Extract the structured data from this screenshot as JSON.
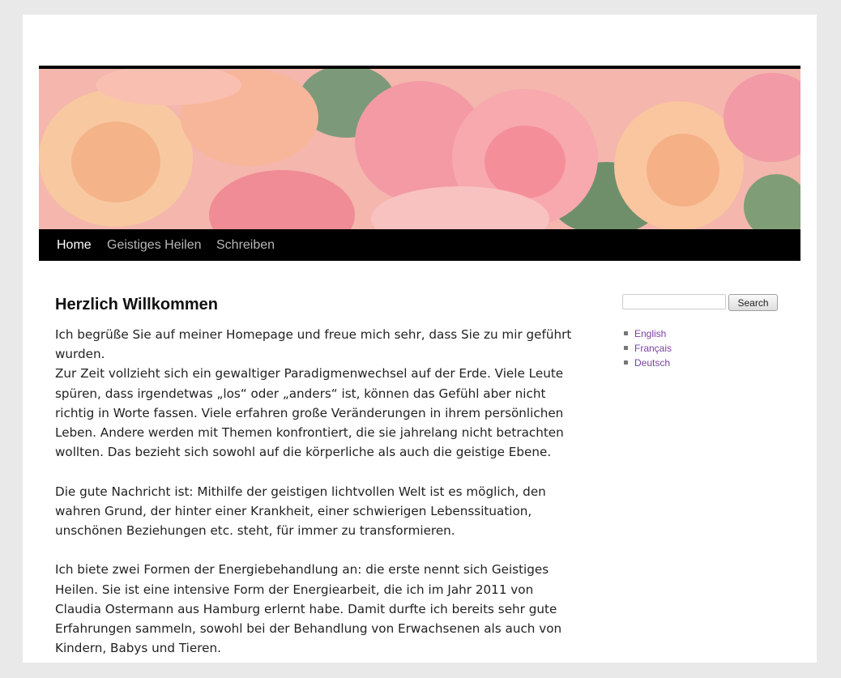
{
  "header_image": {
    "description_icon": "roses-banner"
  },
  "nav": {
    "items": [
      {
        "label": "Home",
        "active": true
      },
      {
        "label": "Geistiges Heilen",
        "active": false
      },
      {
        "label": "Schreiben",
        "active": false
      }
    ]
  },
  "main": {
    "title": "Herzlich Willkommen",
    "paragraphs": [
      "Ich begrüße Sie auf meiner Homepage und freue mich sehr, dass Sie zu mir geführt wurden.",
      "Zur Zeit vollzieht sich ein gewaltiger Paradigmenwechsel auf der Erde. Viele Leute spüren, dass irgendetwas „los“ oder „anders“ ist, können das Gefühl aber nicht richtig in Worte fassen. Viele erfahren große Veränderungen in ihrem persönlichen Leben. Andere werden mit Themen konfrontiert, die sie jahrelang nicht betrachten wollten. Das bezieht sich sowohl auf die körperliche als auch die geistige Ebene.",
      "Die gute Nachricht ist: Mithilfe der geistigen lichtvollen Welt ist es möglich, den wahren Grund, der hinter einer Krankheit, einer schwierigen Lebenssituation, unschönen Beziehungen etc. steht, für immer zu transformieren.",
      "Ich biete zwei Formen der Energiebehandlung an: die erste nennt sich Geistiges Heilen. Sie ist eine intensive Form der Energiearbeit, die ich im Jahr 2011 von Claudia Ostermann aus Hamburg erlernt habe. Damit durfte ich bereits sehr gute Erfahrungen sammeln, sowohl bei der Behandlung von Erwachsenen als auch von Kindern, Babys und Tieren."
    ]
  },
  "sidebar": {
    "search": {
      "value": "",
      "button_label": "Search"
    },
    "languages": [
      "English",
      "Français",
      "Deutsch"
    ]
  },
  "colors": {
    "page_bg": "#e9e9e9",
    "nav_bg": "#000000",
    "nav_active": "#ffffff",
    "nav_inactive": "#b7b7b7",
    "link": "#7b3fa2"
  }
}
